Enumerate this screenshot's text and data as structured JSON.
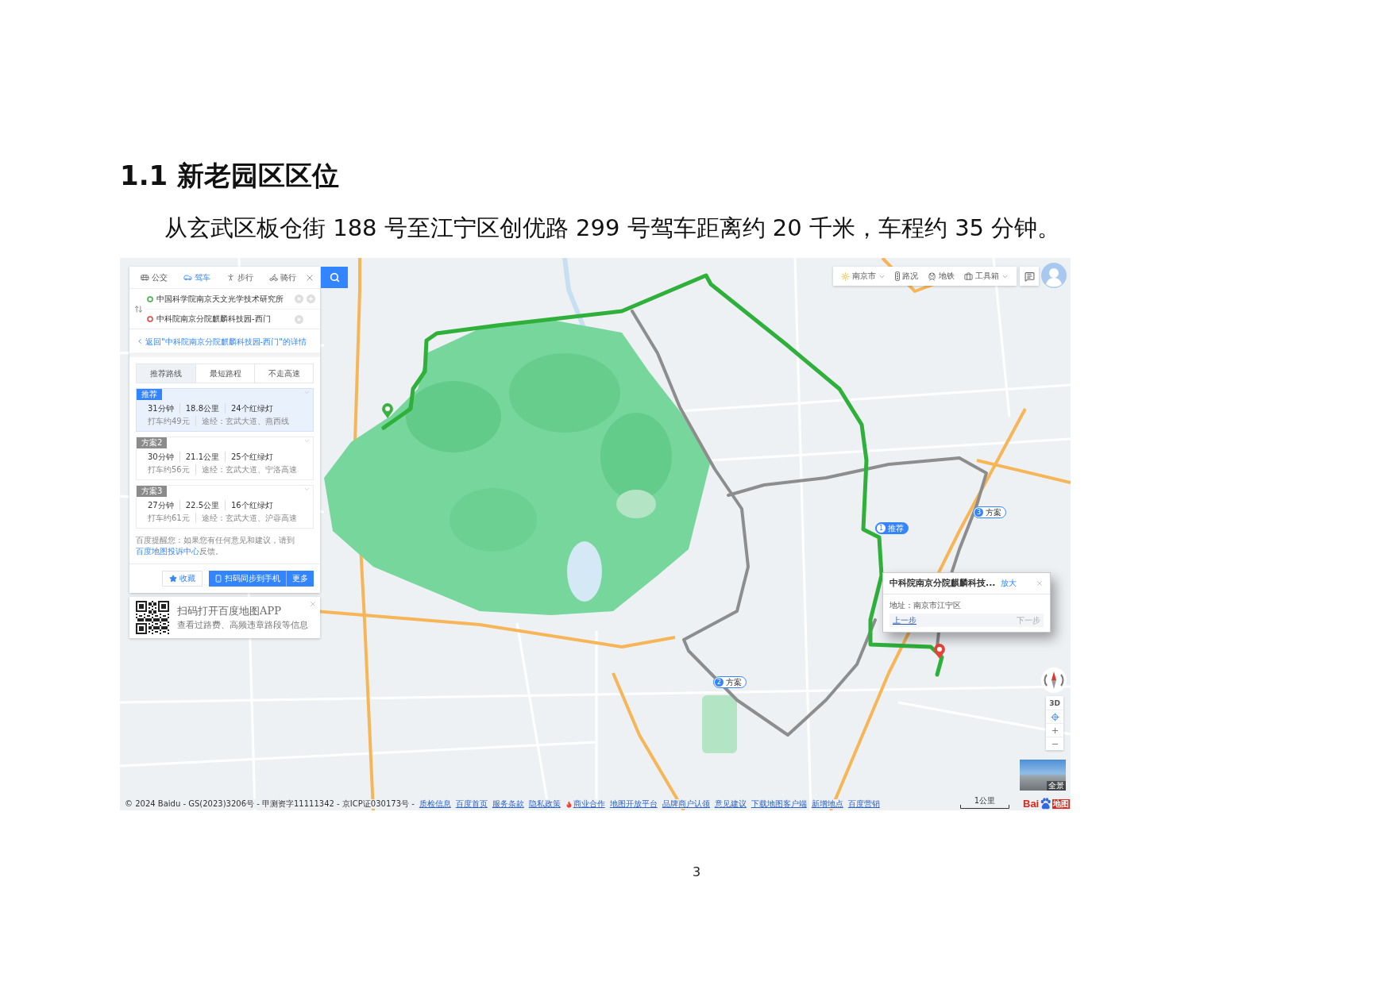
{
  "heading": "1.1 新老园区区位",
  "paragraph": "从玄武区板仓街 188 号至江宁区创优路 299 号驾车距离约 20 千米，车程约 35 分钟。",
  "route_panel": {
    "modes": [
      {
        "label": "公交",
        "selected": false
      },
      {
        "label": "驾车",
        "selected": true
      },
      {
        "label": "步行",
        "selected": false
      },
      {
        "label": "骑行",
        "selected": false
      }
    ],
    "start": "中国科学院南京天文光学技术研究所",
    "end": "中科院南京分院麒麟科技园-西门",
    "back_link": "返回\"中科院南京分院麒麟科技园-西门\"的详情",
    "route_tabs": [
      {
        "label": "推荐路线",
        "selected": true
      },
      {
        "label": "最短路程",
        "selected": false
      },
      {
        "label": "不走高速",
        "selected": false
      }
    ],
    "routes": [
      {
        "tag": "推荐",
        "time": "31分钟",
        "distance": "18.8公里",
        "lights": "24个红绿灯",
        "fare": "打车约49元",
        "via": "途经：玄武大道、燕西线",
        "selected": true
      },
      {
        "tag": "方案2",
        "time": "30分钟",
        "distance": "21.1公里",
        "lights": "25个红绿灯",
        "fare": "打车约56元",
        "via": "途经：玄武大道、宁洛高速",
        "selected": false
      },
      {
        "tag": "方案3",
        "time": "27分钟",
        "distance": "22.5公里",
        "lights": "16个红绿灯",
        "fare": "打车约61元",
        "via": "途经：玄武大道、沪蓉高速",
        "selected": false
      }
    ],
    "notice": {
      "text": "百度提醒您：如果您有任何意见和建议，请到",
      "link": "百度地图投诉中心",
      "tail": "反馈。"
    },
    "actions": {
      "save": "收藏",
      "send": "扫码同步到手机",
      "more": "更多"
    }
  },
  "app_promo": {
    "title": "扫码打开百度地图APP",
    "subtitle": "查看过路费、高频违章路段等信息"
  },
  "map_toolbar": {
    "items": [
      {
        "label": "南京市",
        "kind": "dropdown"
      },
      {
        "label": "路况",
        "kind": "button"
      },
      {
        "label": "地铁",
        "kind": "button"
      },
      {
        "label": "工具箱",
        "kind": "dropdown"
      }
    ]
  },
  "route_markers": [
    {
      "number": "1",
      "label": "推荐",
      "selected": true
    },
    {
      "number": "3",
      "label": "方案",
      "selected": false
    },
    {
      "number": "2",
      "label": "方案",
      "selected": false
    }
  ],
  "info_popup": {
    "title": "中科院南京分院麒麟科技...",
    "zoom": "放大",
    "address": "地址：南京市江宁区",
    "steps": [
      {
        "label": "上一步",
        "disabled": false
      },
      {
        "label": "下一步",
        "disabled": true
      }
    ]
  },
  "map_controls": {
    "view_3d": "3D"
  },
  "street_view": {
    "label": "全景"
  },
  "scale_bar": {
    "label": "1公里"
  },
  "logo": {
    "text": "Bai",
    "suffix": "地图"
  },
  "footer": {
    "copyright": "© 2024 Baidu - GS(2023)3206号 - 甲测资字11111342 - 京ICP证030173号 -",
    "links": [
      {
        "label": "质检信息",
        "hot": false
      },
      {
        "label": "百度首页",
        "hot": false
      },
      {
        "label": "服务条款",
        "hot": false
      },
      {
        "label": "隐私政策",
        "hot": false
      },
      {
        "label": "商业合作",
        "hot": true
      },
      {
        "label": "地图开放平台",
        "hot": false
      },
      {
        "label": "品牌商户认领",
        "hot": false
      },
      {
        "label": "意见建议",
        "hot": false
      },
      {
        "label": "下载地图客户端",
        "hot": false
      },
      {
        "label": "新增地点",
        "hot": false
      },
      {
        "label": "百度营销",
        "hot": false
      }
    ]
  },
  "page_number": "3"
}
